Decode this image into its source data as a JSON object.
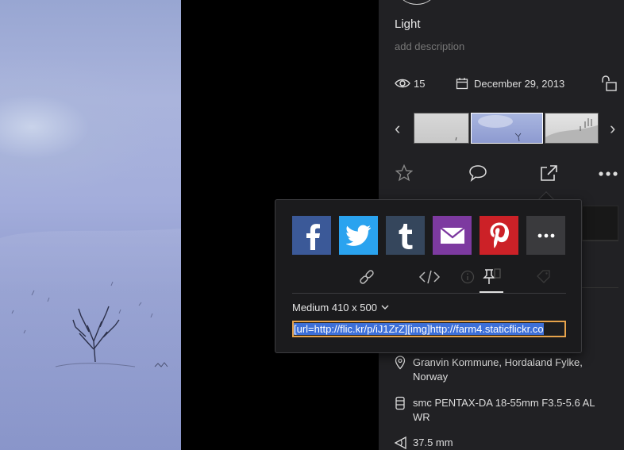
{
  "photo": {
    "title": "Light",
    "description_placeholder": "add description",
    "views": "15",
    "date_taken": "December 29, 2013"
  },
  "icons": {
    "views": "eye-icon",
    "date": "calendar-icon",
    "privacy": "unlock-icon",
    "prev": "chevron-left-icon",
    "next": "chevron-right-icon",
    "favorite": "star-icon",
    "comment": "speech-bubble-icon",
    "share": "share-icon",
    "more": "more-icon",
    "location": "map-pin-icon",
    "lens": "lens-icon",
    "focal": "focal-length-icon"
  },
  "share": {
    "services": [
      {
        "name": "facebook",
        "glyph": "f",
        "color": "#3b5998"
      },
      {
        "name": "twitter",
        "color": "#2aa3ef"
      },
      {
        "name": "tumblr",
        "glyph": "t",
        "color": "#35465c"
      },
      {
        "name": "email",
        "color": "#7d3aa0"
      },
      {
        "name": "pinterest",
        "color": "#cc2127"
      },
      {
        "name": "more",
        "glyph": "•••",
        "color": "#3a3a3d"
      }
    ],
    "tabs": [
      {
        "name": "link-icon"
      },
      {
        "name": "embed-icon"
      },
      {
        "name": "info-icon"
      },
      {
        "name": "pin-icon",
        "active": true
      },
      {
        "name": "tag-icon"
      }
    ],
    "size_select": "Medium 410 x 500",
    "bbcode_value": "[url=http://flic.kr/p/iJ1ZrZ][img]http://farm4.staticflickr.co"
  },
  "info": {
    "location": "Granvin Kommune, Hordaland Fylke, Norway",
    "lens": "smc PENTAX-DA 18-55mm F3.5-5.6 AL WR",
    "focal_length": "37.5 mm"
  },
  "colors": {
    "panel_bg": "#212124",
    "popup_bg": "#1b1b1d",
    "focus_border": "#e7a34b",
    "selection": "#3d6fd8"
  }
}
